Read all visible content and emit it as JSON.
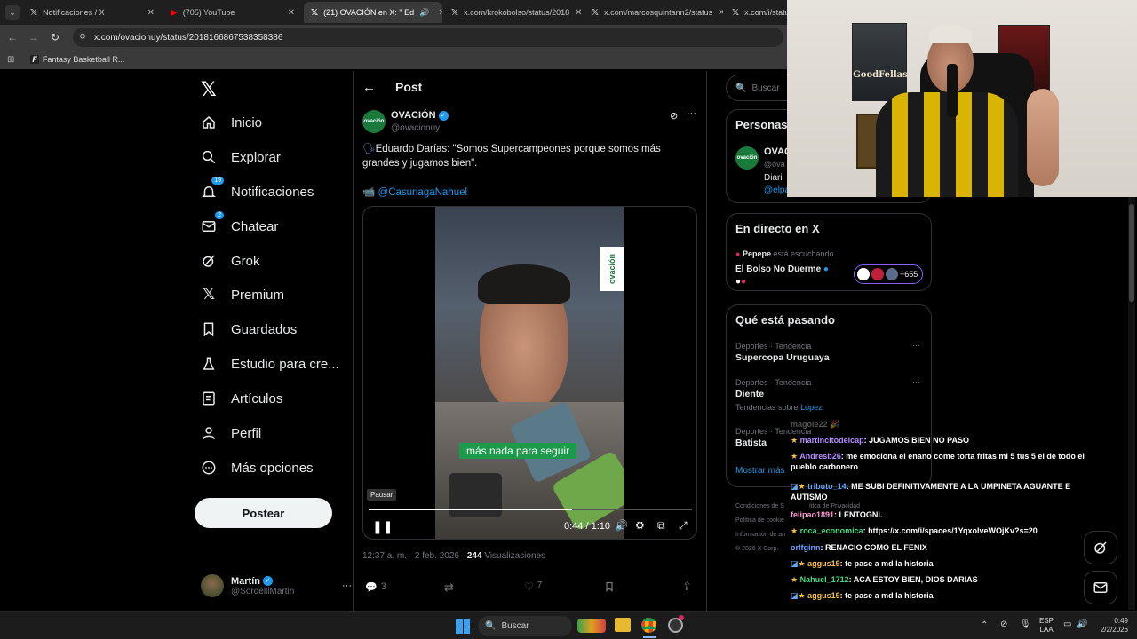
{
  "browser": {
    "tabs": [
      {
        "label": "Notificaciones / X",
        "icon": "x-logo"
      },
      {
        "label": "(705) YouTube",
        "icon": "youtube-logo"
      },
      {
        "label": "(21) OVACIÓN en X: \" Ed",
        "icon": "x-logo"
      },
      {
        "label": "x.com/krokobolso/status/2018",
        "icon": "x-logo"
      },
      {
        "label": "x.com/marcosquintann2/status",
        "icon": "x-logo"
      },
      {
        "label": "x.com/i/statu",
        "icon": "x-logo"
      }
    ],
    "url": "x.com/ovacionuy/status/2018166867538358386",
    "bookmark": "Fantasy Basketball R..."
  },
  "nav": {
    "items": [
      {
        "label": "Inicio",
        "icon": "home-icon"
      },
      {
        "label": "Explorar",
        "icon": "search-icon"
      },
      {
        "label": "Notificaciones",
        "icon": "bell-icon",
        "badge": "19"
      },
      {
        "label": "Chatear",
        "icon": "mail-icon",
        "badge": "2"
      },
      {
        "label": "Grok",
        "icon": "grok-icon"
      },
      {
        "label": "Premium",
        "icon": "x-icon"
      },
      {
        "label": "Guardados",
        "icon": "bookmark-icon"
      },
      {
        "label": "Estudio para cre...",
        "icon": "flask-icon"
      },
      {
        "label": "Artículos",
        "icon": "article-icon"
      },
      {
        "label": "Perfil",
        "icon": "person-icon"
      },
      {
        "label": "Más opciones",
        "icon": "more-circle-icon"
      }
    ],
    "post_button": "Postear",
    "account": {
      "name": "Martín",
      "handle": "@SordelliMartin"
    }
  },
  "post": {
    "header": "Post",
    "author_name": "OVACIÓN",
    "author_handle": "@ovacionuy",
    "avatar_text": "ovación",
    "text": "Eduardo Darías: \"Somos Supercampeones porque somos más grandes y jugamos bien\".",
    "mention": "@CasuriagaNahuel",
    "video_caption": "más nada para seguir",
    "video_watermark": "ovación",
    "tooltip": "Pausar",
    "time": "0:44 / 1:10",
    "progress": 0.63,
    "meta_time": "12:37 a. m. · 2 feb. 2026 ·",
    "views_count": "244",
    "views_label": "Visualizaciones",
    "replies": "3",
    "likes": "7"
  },
  "right": {
    "search_placeholder": "Buscar",
    "personas_title": "Personas",
    "personas_name": "OVAC",
    "personas_handle": "@ova",
    "personas_bio": "Diari",
    "personas_link": "@elpa",
    "live_title": "En directo en X",
    "live_user": "Pepepe",
    "live_status": "está escuchando",
    "live_space": "El Bolso No Duerme",
    "live_count": "+655",
    "trends_title": "Qué está pasando",
    "trends": [
      {
        "meta": "Deportes · Tendencia",
        "name": "Supercopa Uruguaya"
      },
      {
        "meta": "Deportes · Tendencia",
        "name": "Diente",
        "extra": "Tendencias sobre",
        "extra_link": "López"
      },
      {
        "meta": "Deportes · Tendencia",
        "name": "Batista"
      }
    ],
    "show_more": "Mostrar más",
    "footer": [
      "Condiciones de S",
      "ítica de Privacidad",
      "Política de cookie",
      "Información de an",
      "© 2026 X Corp."
    ]
  },
  "chat": [
    {
      "user": "magole22",
      "msg": "",
      "color": "#9a9a9a"
    },
    {
      "user": "martincitodelcap",
      "msg": ": JUGAMOS BIEN NO PASO",
      "color": "#b48cff"
    },
    {
      "user": "Andresb26",
      "msg": ": me emociona el enano come torta fritas mi 5 tus 5 el de todo el pueblo carbonero",
      "color": "#b48cff"
    },
    {
      "user": "tributo_14",
      "msg": ": ME SUBI DEFINITIVAMENTE A LA UMPINETA AGUANTE E AUTISMO",
      "color": "#5fa8ff"
    },
    {
      "user": "felipao1891",
      "msg": ": LENTOGNI.",
      "color": "#ff9ad5"
    },
    {
      "user": "roca_economica",
      "msg": ": https://x.com/i/spaces/1YqxolveWOjKv?s=20",
      "color": "#3ddc84"
    },
    {
      "user": "orlfginn",
      "msg": ": RENACIO COMO EL FENIX",
      "color": "#6aa3ff"
    },
    {
      "user": "aggus19",
      "msg": ": te pase a md la historia",
      "color": "#f5c242"
    },
    {
      "user": "Nahuel_1712",
      "msg": ": ACA ESTOY BIEN, DIOS DARIAS",
      "color": "#3ddc84"
    },
    {
      "user": "aggus19",
      "msg": ": te pase a md la historia",
      "color": "#f5c242"
    }
  ],
  "taskbar": {
    "search": "Buscar",
    "lang1": "ESP",
    "lang2": "LAA",
    "time": "0:49",
    "date": "2/2/2026"
  },
  "webcam": {
    "poster1": "GoodFellas"
  }
}
